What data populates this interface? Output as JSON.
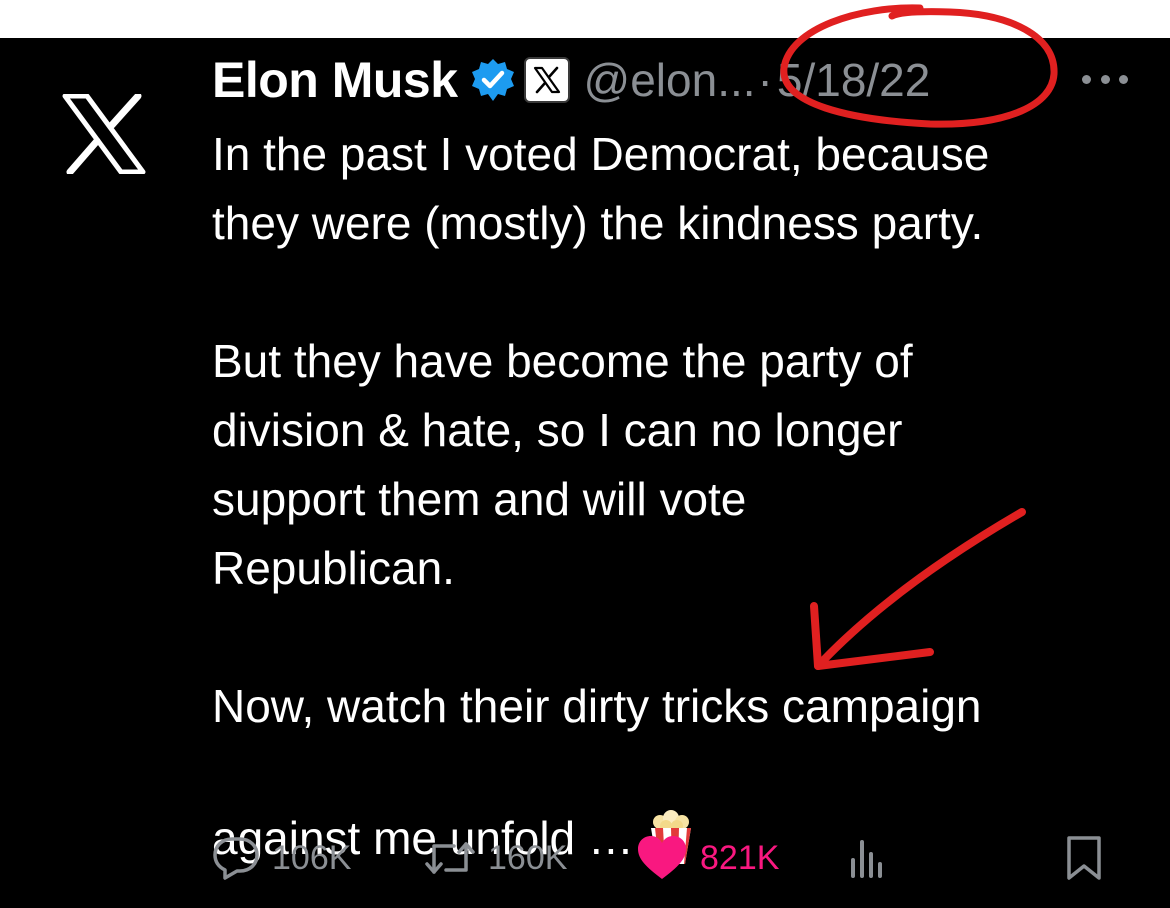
{
  "tweet": {
    "author_name": "Elon Musk",
    "handle": "@elon...",
    "separator": "·",
    "date": "5/18/22",
    "paragraphs": [
      "In the past I voted Democrat, because\nthey were (mostly) the kindness party.",
      "But they have become the party of\ndivision & hate, so I can no longer\nsupport them and will vote\nRepublican."
    ],
    "last_paragraph": "Now, watch their dirty tricks campaign\nagainst me unfold …",
    "emoji": "popcorn"
  },
  "actions": {
    "reply_count": "106K",
    "repost_count": "160K",
    "like_count": "821K",
    "like_color": "#f91880"
  },
  "icons": [
    "x-logo-icon",
    "verified-badge-icon",
    "x-affiliate-badge-icon",
    "more-icon",
    "reply-icon",
    "repost-icon",
    "like-icon",
    "views-icon",
    "bookmark-icon",
    "popcorn-icon"
  ],
  "annotations": {
    "color": "#e02020",
    "marks": [
      "circle around date",
      "arrow pointing to text"
    ]
  }
}
